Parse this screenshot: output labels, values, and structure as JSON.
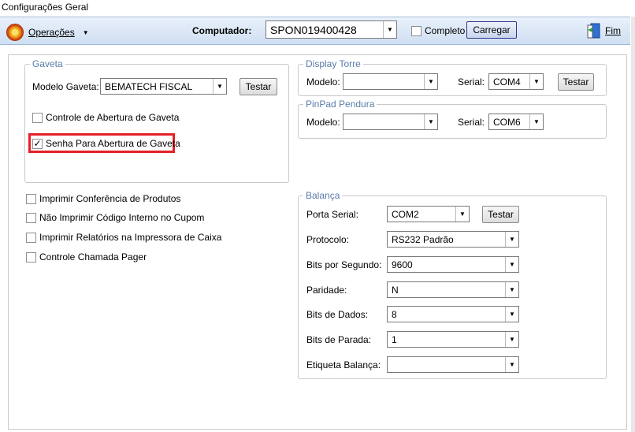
{
  "window": {
    "title": "Configurações Geral"
  },
  "toolbar": {
    "operacoes_label": "Operações",
    "computador_label": "Computador:",
    "computador_value": "SPON019400428",
    "completo_label": "Completo",
    "carregar_label": "Carregar",
    "fim_label": "Fim"
  },
  "gaveta": {
    "legend": "Gaveta",
    "modelo_label": "Modelo Gaveta:",
    "modelo_value": "BEMATECH FISCAL",
    "testar_label": "Testar",
    "controle_label": "Controle de Abertura de Gaveta",
    "controle_checked": false,
    "senha_label": "Senha Para Abertura de Gaveta",
    "senha_checked": true
  },
  "options": [
    {
      "label": "Imprimir Conferência de Produtos",
      "checked": false
    },
    {
      "label": "Não Imprimir Código Interno no Cupom",
      "checked": false
    },
    {
      "label": "Imprimir Relatórios na Impressora de Caixa",
      "checked": false
    },
    {
      "label": "Controle Chamada Pager",
      "checked": false
    }
  ],
  "display_torre": {
    "legend": "Display Torre",
    "modelo_label": "Modelo:",
    "modelo_value": "",
    "serial_label": "Serial:",
    "serial_value": "COM4",
    "testar_label": "Testar"
  },
  "pinpad": {
    "legend": "PinPad Pendura",
    "modelo_label": "Modelo:",
    "modelo_value": "",
    "serial_label": "Serial:",
    "serial_value": "COM6"
  },
  "balanca": {
    "legend": "Balança",
    "porta_label": "Porta Serial:",
    "porta_value": "COM2",
    "testar_label": "Testar",
    "protocolo_label": "Protocolo:",
    "protocolo_value": "RS232 Padrão",
    "bits_seg_label": "Bits por Segundo:",
    "bits_seg_value": "9600",
    "paridade_label": "Paridade:",
    "paridade_value": "N",
    "bits_dados_label": "Bits de Dados:",
    "bits_dados_value": "8",
    "bits_parada_label": "Bits de Parada:",
    "bits_parada_value": "1",
    "etiqueta_label": "Etiqueta Balança:",
    "etiqueta_value": ""
  },
  "icons": {
    "operacoes": "gear-icon",
    "fim": "exit-door-icon",
    "dropdown": "chevron-down-icon"
  },
  "colors": {
    "accent_border": "#e52027",
    "legend": "#5a7ca8",
    "toolbar": "#cfdff2"
  }
}
